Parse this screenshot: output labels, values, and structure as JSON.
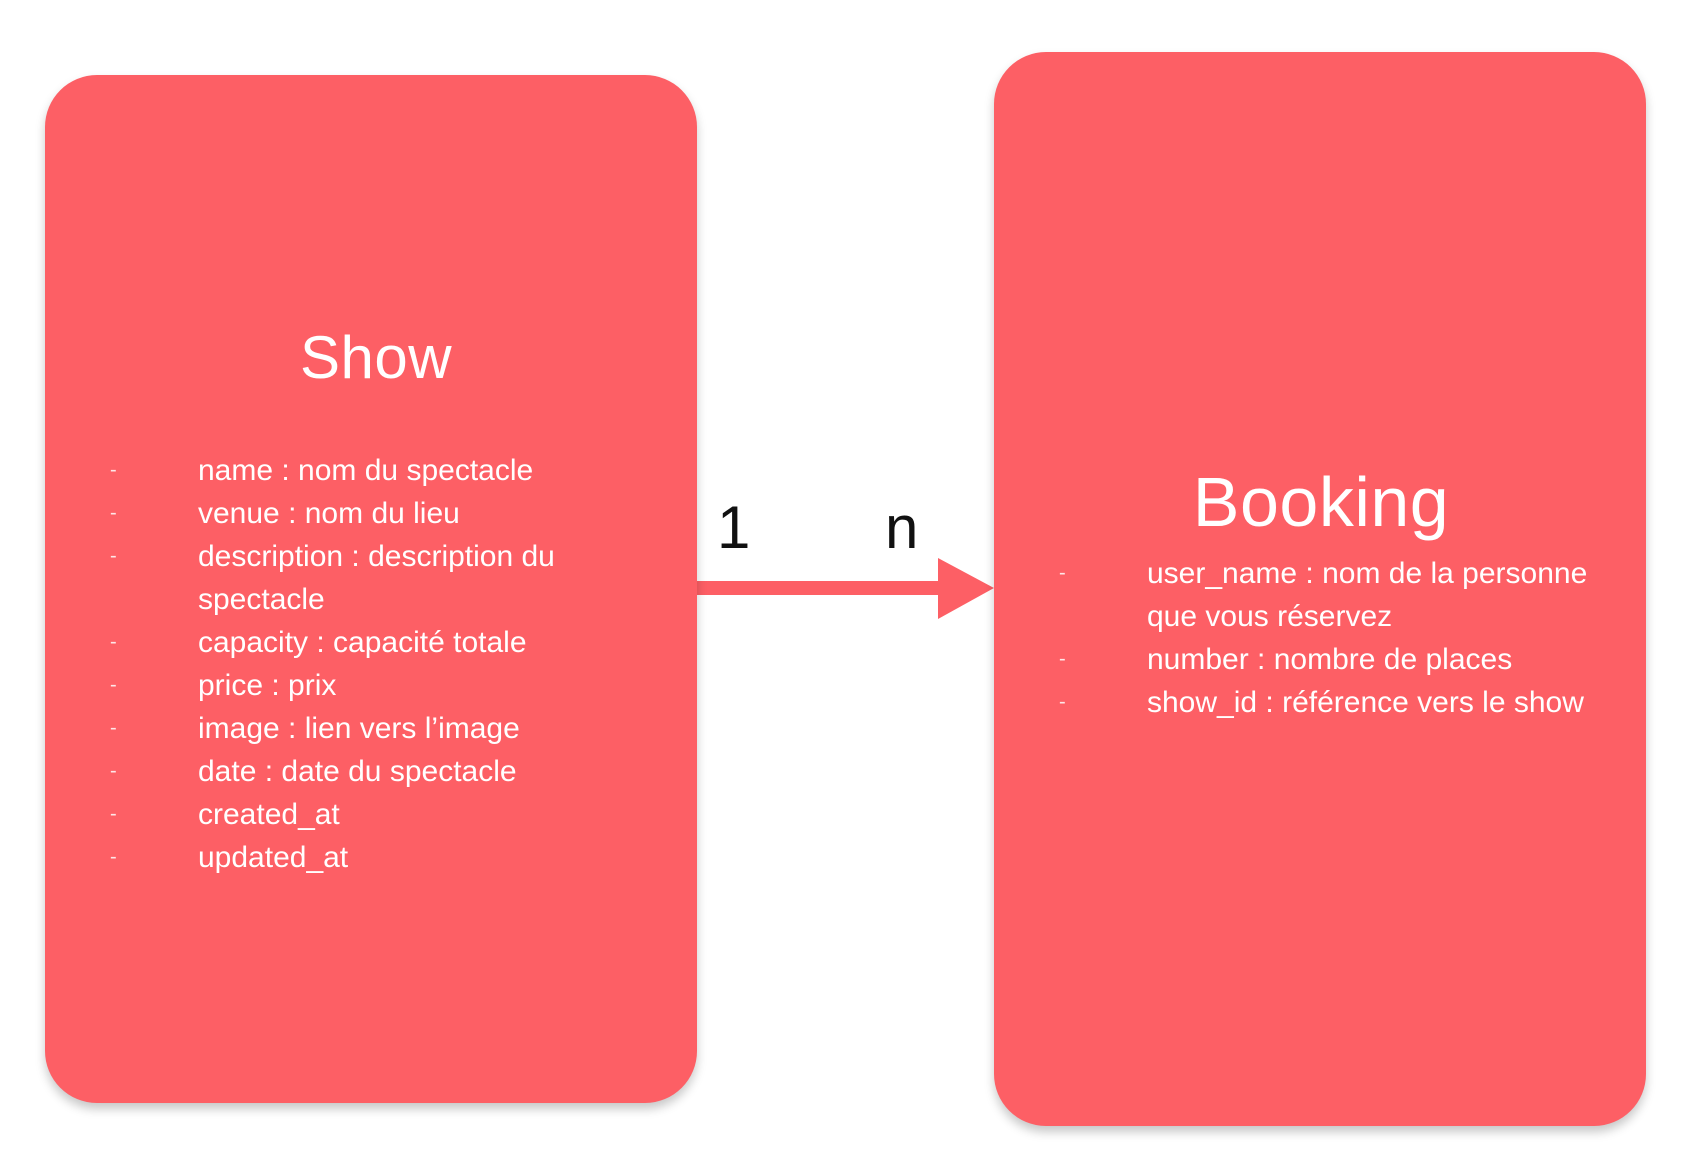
{
  "entities": {
    "show": {
      "title": "Show",
      "fields": [
        "name : nom du spectacle",
        "venue : nom du lieu",
        "description : description du spectacle",
        "capacity : capacité totale",
        "price : prix",
        "image : lien vers l’image",
        "date : date du spectacle",
        "created_at",
        "updated_at"
      ]
    },
    "booking": {
      "title": "Booking",
      "fields": [
        "user_name : nom de la personne que vous réservez",
        "number : nombre de places",
        "show_id : référence vers le show"
      ]
    }
  },
  "relationship": {
    "from_cardinality": "1",
    "to_cardinality": "n",
    "arrow_direction": "show-to-booking"
  },
  "colors": {
    "card": "#fd5f65",
    "arrow": "#fd5f65",
    "card_text": "#ffffff",
    "label_text": "#111111"
  },
  "list_marker": "-"
}
